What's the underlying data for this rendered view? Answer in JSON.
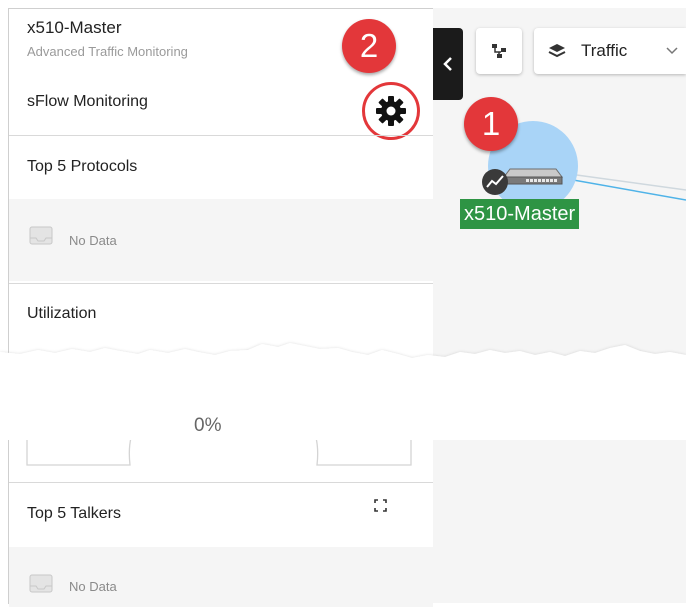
{
  "panel": {
    "device_name": "x510-Master",
    "device_subtitle": "Advanced Traffic Monitoring",
    "sflow_label": "sFlow Monitoring",
    "sections": {
      "protocols": {
        "title": "Top 5 Protocols",
        "empty_text": "No Data"
      },
      "utilization": {
        "title": "Utilization",
        "value": "0%"
      },
      "talkers": {
        "title": "Top 5 Talkers",
        "empty_text": "No Data"
      }
    }
  },
  "toolbar": {
    "layer_select_value": "Traffic"
  },
  "map": {
    "node_label": "x510-Master"
  },
  "callouts": {
    "node_badge": "1",
    "settings_badge": "2"
  },
  "colors": {
    "callout": "#e3373a",
    "node_label_bg": "#2e9444",
    "node_halo": "#a9d4f7",
    "collapse_button": "#1b1b1b"
  },
  "icons": {
    "settings": "gear-icon",
    "collapse": "chevron-left-icon",
    "topology": "topology-icon",
    "layers": "layers-icon",
    "dropdown": "chevron-down-icon",
    "empty": "inbox-icon",
    "expand": "fullscreen-icon",
    "traffic": "traffic-chart-icon",
    "device": "switch-device-icon"
  }
}
